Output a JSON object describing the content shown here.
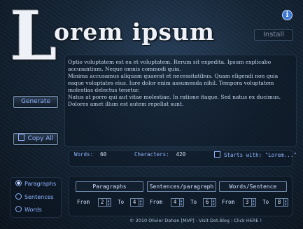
{
  "app": {
    "logo_initial": "L",
    "logo_rest": "orem ipsum",
    "install_label": "Install"
  },
  "generated": {
    "paragraphs": [
      "Optio voluptatem est ea et voluptatem. Rerum sit expedita. Ipsum explicabo accusantium. Neque omnis commodi quia.",
      "Minima accusamus aliquam quaerat et necessitatibus. Quam eligendi non quia eaque voluptates eius. Iure dolor enim assumenda nihil. Tempora voluptatem molestias delectus tenetur.",
      "Natus at porro qui aut vitae molestiae. In ratione itaque. Sed natus ex ducimus. Dolores amet illum est autem repellat sunt."
    ]
  },
  "actions": {
    "generate_label": "Generate",
    "copy_all_label": "Copy All"
  },
  "stats": {
    "words_label": "Words:",
    "words_value": "60",
    "characters_label": "Characters:",
    "characters_value": "420",
    "starts_with_label": "Starts with: \"Lorem...\"",
    "starts_with_checked": false
  },
  "mode": {
    "options": [
      "Paragraphs",
      "Sentences",
      "Words"
    ],
    "selected": "Paragraphs"
  },
  "settings": {
    "from_label": "From",
    "to_label": "To",
    "paragraphs": {
      "header": "Paragraphs",
      "from": "2",
      "to": "4"
    },
    "sentences": {
      "header": "Sentences/paragraph",
      "from": "4",
      "to": "6"
    },
    "words": {
      "header": "Words/Sentence",
      "from": "3",
      "to": "8"
    }
  },
  "footer": {
    "text": "© 2010 Olivier Dahan [MVP] - Visit Dot.Blog : Click HERE !"
  },
  "colors": {
    "accent": "#8fb4ff",
    "background": "#152536"
  }
}
